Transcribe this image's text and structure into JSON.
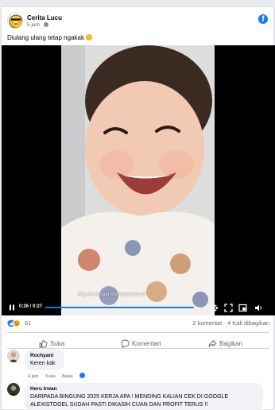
{
  "post": {
    "page_name": "Cerita Lucu",
    "time": "5 jam",
    "caption": "Diulang ulang tetap ngakak"
  },
  "video": {
    "overlay_text": "Dig ini sangat memperkukuan",
    "time": "0:26 / 0:27",
    "progress": 0.96
  },
  "stats": {
    "reaction_count": "61",
    "comments": "2 komentar",
    "shares": "4 Kali dibagikan"
  },
  "actions": {
    "like": "Suka",
    "comment": "Komentari",
    "share": "Bagikan"
  },
  "comments": [
    {
      "name": "Rochyani",
      "text": "Keren kak",
      "time": "4 jam",
      "like": "Suka",
      "reply": "Balas"
    },
    {
      "name": "Heru Irwan",
      "text": "DARIPADA BINGUNG 2025 KERJA APA ! MENDING KALIAN CEK DI GOOGLE ALEXISTOGEL SUDAH PASTI DIKASIH CUAN DAN PROFIT TERUS !!"
    }
  ],
  "colors": {
    "accent": "#1877f2",
    "background": "#e9ebee",
    "card": "#ffffff",
    "secondary_text": "#65676b"
  }
}
